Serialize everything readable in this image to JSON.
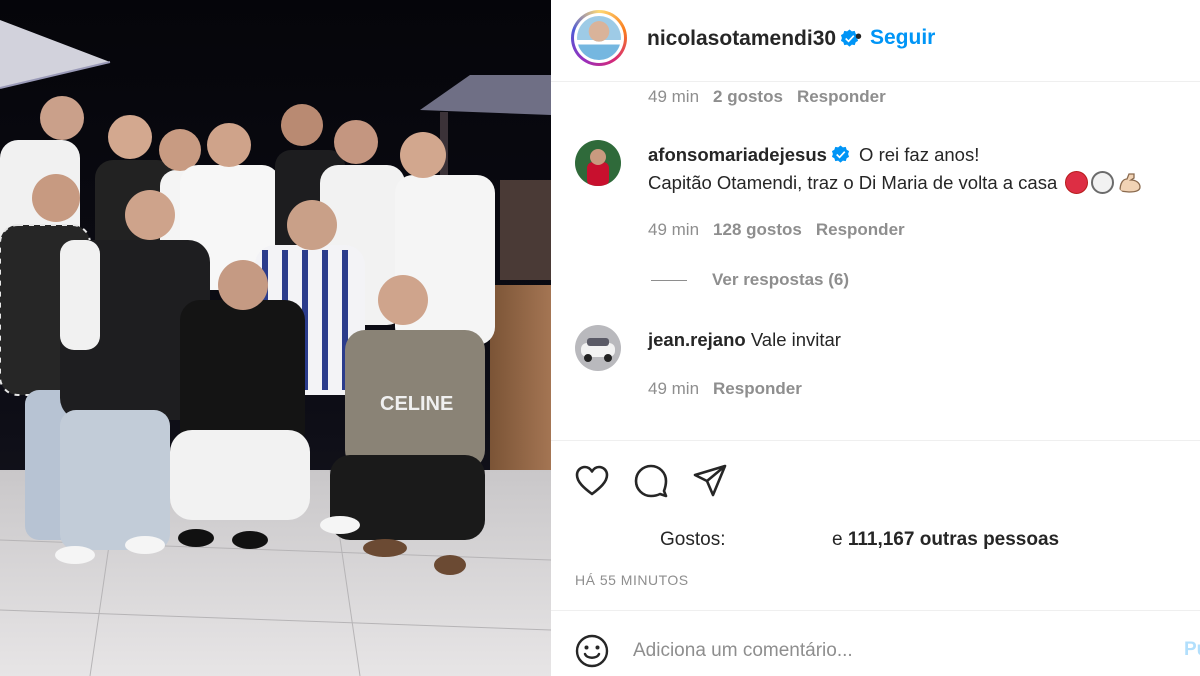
{
  "post": {
    "author": "nicolasotamendi30",
    "separator": "•",
    "follow_label": "Seguir",
    "image_alt": "Group photo of smiling men at a night party"
  },
  "comments": [
    {
      "time": "49 min",
      "likes": "2 gostos",
      "reply_label": "Responder"
    },
    {
      "username": "afonsomariadejesus",
      "verified": true,
      "line1": "O rei faz anos!",
      "line2": "Capitão Otamendi, traz o Di Maria de volta a casa",
      "emojis": [
        "red-circle",
        "white-circle",
        "flexed-biceps"
      ],
      "time": "49 min",
      "likes": "128 gostos",
      "reply_label": "Responder",
      "view_replies": "Ver respostas (6)"
    },
    {
      "username": "jean.rejano",
      "text": "Vale invitar",
      "time": "49 min",
      "reply_label": "Responder"
    }
  ],
  "actions": {
    "icons": [
      "heart-icon",
      "comment-icon",
      "share-icon"
    ]
  },
  "likes": {
    "label": "Gostos:",
    "others_prefix": "e",
    "others_bold": "111,167 outras pessoas"
  },
  "timestamp": "HÁ 55 MINUTOS",
  "composer": {
    "placeholder": "Adiciona um comentário...",
    "post_label": "Pu"
  },
  "colors": {
    "accent": "#0095f6",
    "muted": "#8e8e8e",
    "text": "#262626",
    "verified": "#0095f6"
  }
}
